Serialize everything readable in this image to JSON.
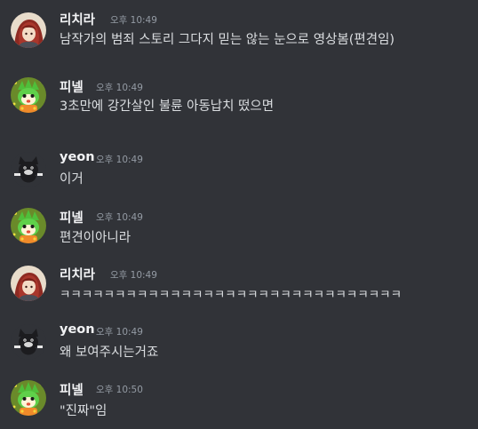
{
  "users": {
    "richira": {
      "name": "리치라",
      "avatar_icon": "red-haired-character-avatar-icon"
    },
    "pinel": {
      "name": "피넬",
      "avatar_icon": "green-creature-avatar-icon"
    },
    "yeon": {
      "name": "yeon",
      "avatar_icon": "black-cat-avatar-icon"
    }
  },
  "messages": [
    {
      "author": "리치라",
      "time": "오후 10:49",
      "text": "남작가의 범죄 스토리 그다지 믿는 않는 눈으로 영상봄(편견임)"
    },
    {
      "author": "피넬",
      "time": "오후 10:49",
      "text": "3초만에 강간살인 불륜 아동납치 떴으면"
    },
    {
      "author": "yeon",
      "time": "오후 10:49",
      "text": "이거"
    },
    {
      "author": "피넬",
      "time": "오후 10:49",
      "text": "편견이아니라"
    },
    {
      "author": "리치라",
      "time": "오후 10:49",
      "text": "ㅋㅋㅋㅋㅋㅋㅋㅋㅋㅋㅋㅋㅋㅋㅋㅋㅋㅋㅋㅋㅋㅋㅋㅋㅋㅋㅋㅋㅋㅋㅋ"
    },
    {
      "author": "yeon",
      "time": "오후 10:49",
      "text": "왜 보여주시는거죠"
    },
    {
      "author": "피넬",
      "time": "오후 10:50",
      "text": "\"진짜\"임"
    }
  ],
  "colors": {
    "background": "#313338",
    "username": "#f2f3f5",
    "timestamp": "#949ba4",
    "message_text": "#dbdee1"
  }
}
